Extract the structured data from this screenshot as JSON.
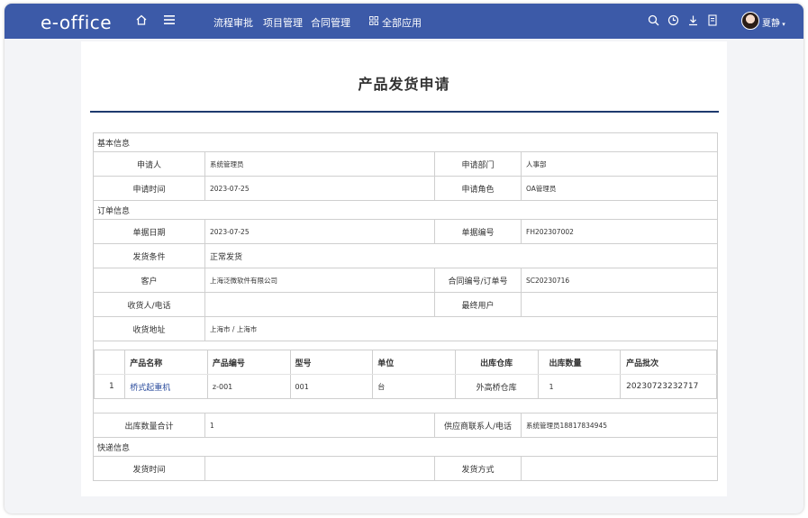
{
  "topbar": {
    "logo": "e-office",
    "nav": [
      "流程审批",
      "项目管理",
      "合同管理"
    ],
    "all_apps": "全部应用",
    "user_name": "夏静"
  },
  "page": {
    "title": "产品发货申请"
  },
  "basic": {
    "section": "基本信息",
    "applicant_label": "申请人",
    "applicant": "系统管理员",
    "dept_label": "申请部门",
    "dept": "人事部",
    "time_label": "申请时间",
    "time": "2023-07-25",
    "role_label": "申请角色",
    "role": "OA管理员"
  },
  "order": {
    "section": "订单信息",
    "date_label": "单据日期",
    "date": "2023-07-25",
    "no_label": "单据编号",
    "no": "FH202307002",
    "cond_label": "发货条件",
    "cond": "正常发货",
    "customer_label": "客户",
    "customer": "上海泛微软件有限公司",
    "contract_label": "合同编号/订单号",
    "contract": "SC20230716",
    "receiver_label": "收货人/电话",
    "receiver": "",
    "enduser_label": "最终用户",
    "enduser": "",
    "address_label": "收货地址",
    "address": "上海市 / 上海市",
    "columns": [
      "产品名称",
      "产品编号",
      "型号",
      "单位",
      "出库仓库",
      "出库数量",
      "产品批次"
    ],
    "rows": [
      {
        "index": "1",
        "name": "桥式起重机",
        "code": "z-001",
        "model": "001",
        "unit": "台",
        "warehouse": "外高桥仓库",
        "qty": "1",
        "batch": "20230723232717"
      }
    ],
    "total_label": "出库数量合计",
    "total": "1",
    "supplier_label": "供应商联系人/电话",
    "supplier": "系统管理员18817834945"
  },
  "express": {
    "section": "快递信息",
    "time_label": "发货时间",
    "time": "",
    "method_label": "发货方式",
    "method": ""
  }
}
